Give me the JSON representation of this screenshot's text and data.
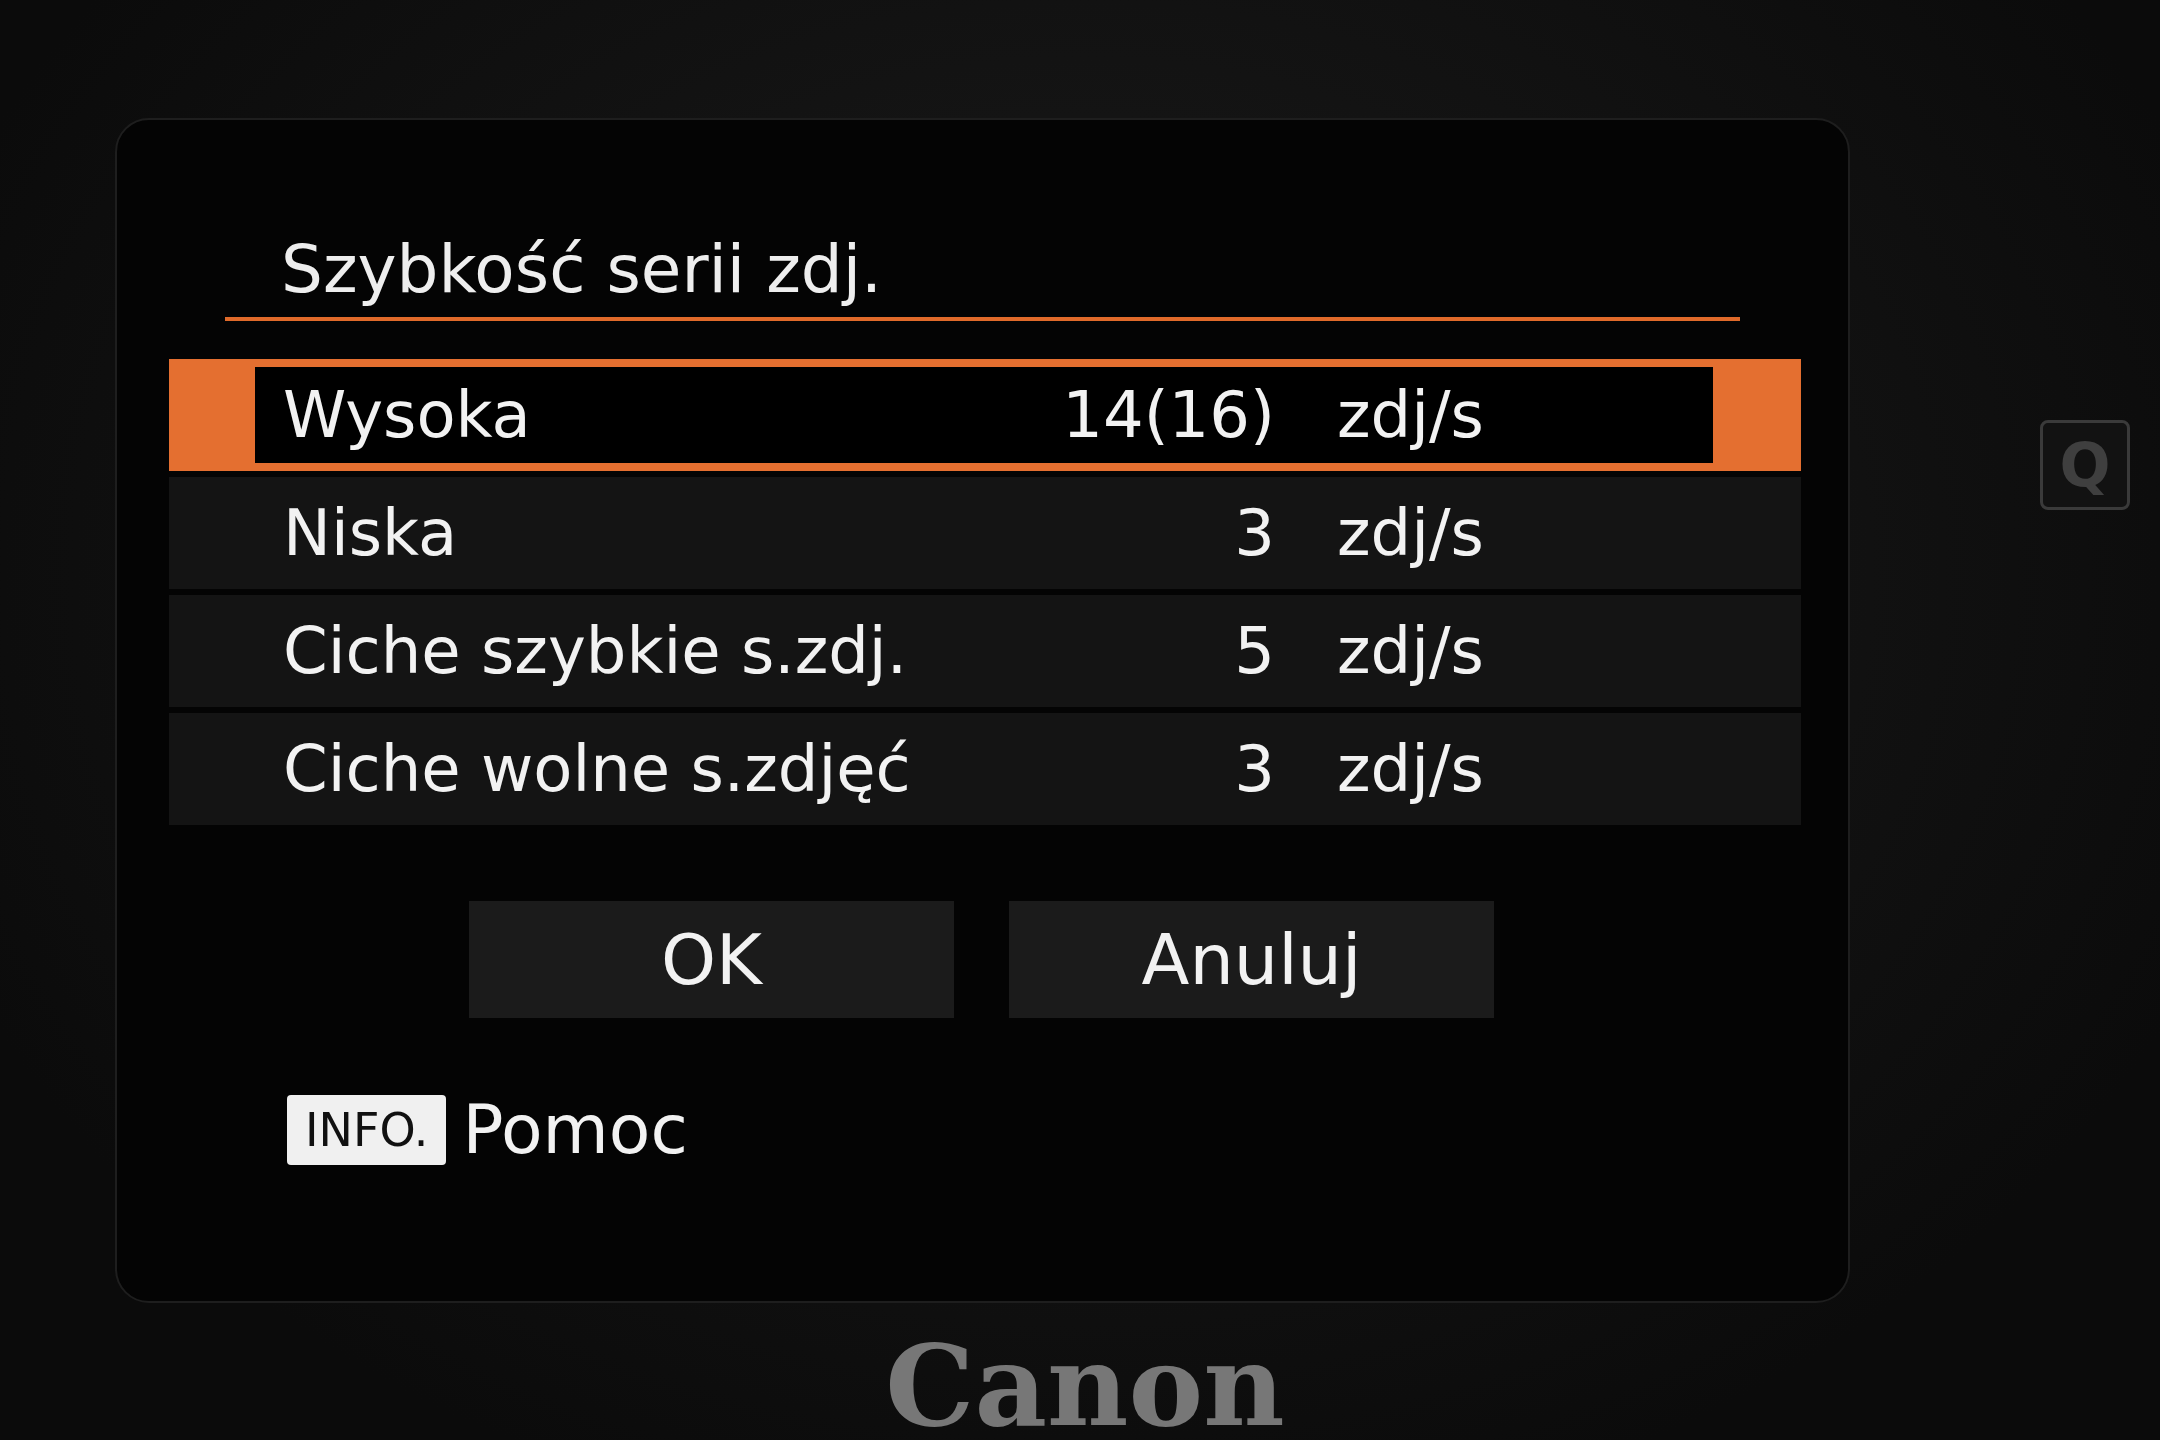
{
  "screen": {
    "title": "Szybkość serii zdj.",
    "options": [
      {
        "label": "Wysoka",
        "value": "14(16)",
        "unit": "zdj/s",
        "selected": true
      },
      {
        "label": "Niska",
        "value": "3",
        "unit": "zdj/s",
        "selected": false
      },
      {
        "label": "Ciche szybkie s.zdj.",
        "value": "5",
        "unit": "zdj/s",
        "selected": false
      },
      {
        "label": "Ciche wolne s.zdjęć",
        "value": "3",
        "unit": "zdj/s",
        "selected": false
      }
    ],
    "buttons": [
      {
        "label": "OK"
      },
      {
        "label": "Anuluj"
      }
    ],
    "help": {
      "key": "INFO.",
      "label": "Pomoc"
    }
  },
  "camera": {
    "brand": "Canon",
    "q_button": "Q"
  }
}
